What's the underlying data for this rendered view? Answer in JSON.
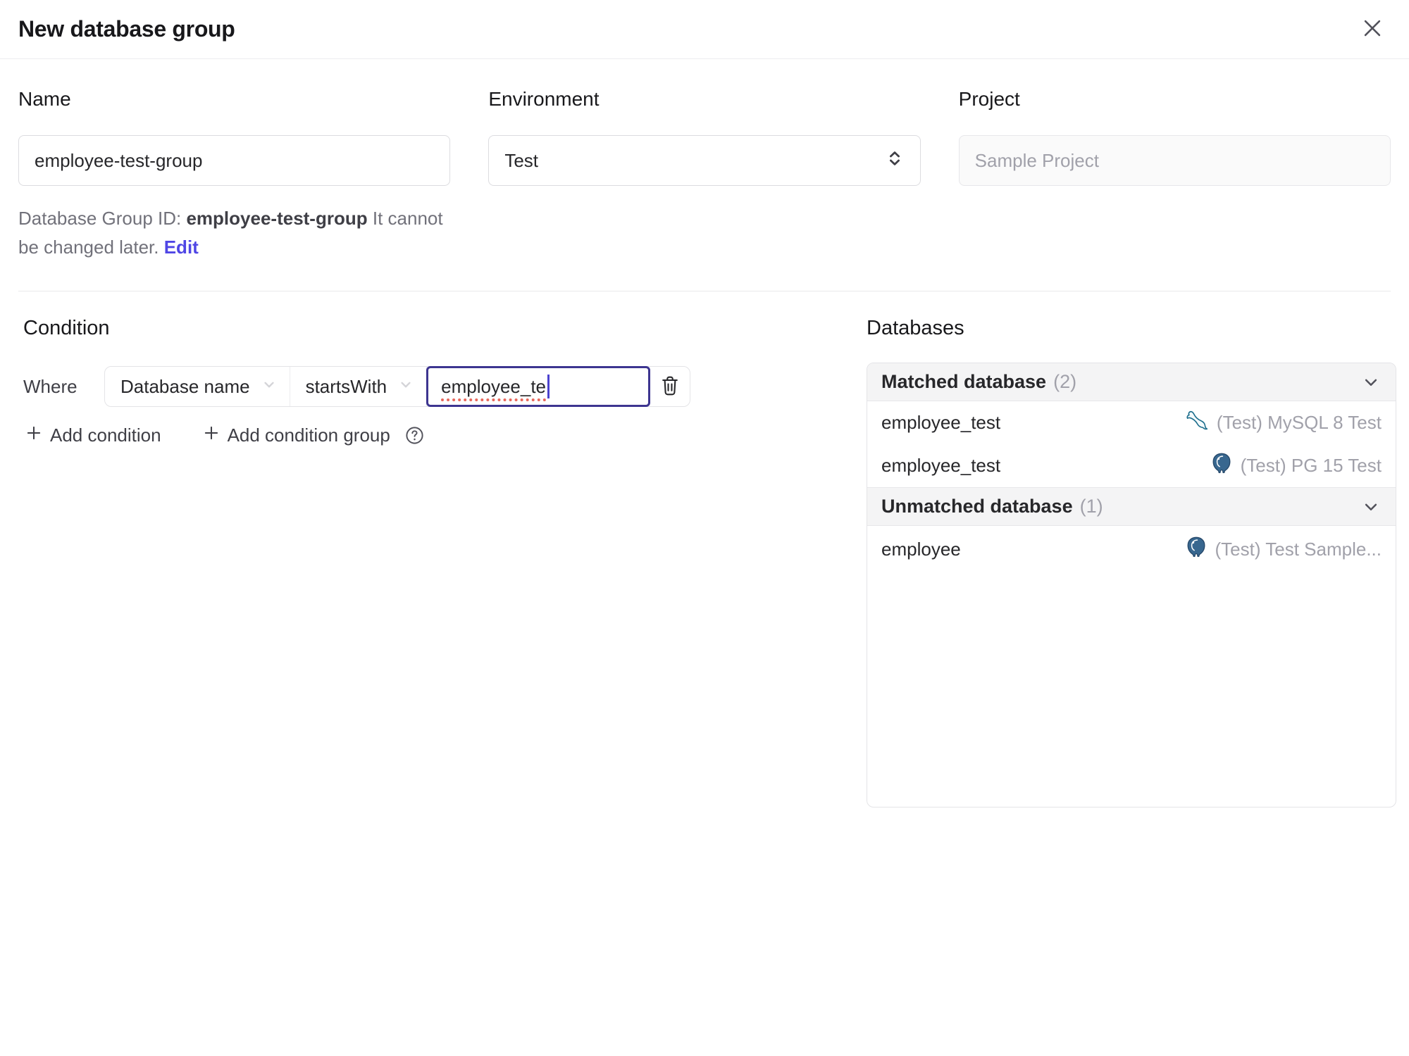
{
  "dialog": {
    "title": "New database group"
  },
  "form": {
    "name": {
      "label": "Name",
      "value": "employee-test-group"
    },
    "environment": {
      "label": "Environment",
      "value": "Test"
    },
    "project": {
      "label": "Project",
      "value": "Sample Project"
    },
    "id_hint": {
      "prefix": "Database Group ID: ",
      "id": "employee-test-group",
      "suffix": " It cannot be changed later. ",
      "edit": "Edit"
    }
  },
  "condition": {
    "heading": "Condition",
    "where": "Where",
    "factor": "Database name",
    "operator": "startsWith",
    "value": "employee_te",
    "add_condition": "Add condition",
    "add_condition_group": "Add condition group",
    "plus": "+"
  },
  "databases": {
    "heading": "Databases",
    "matched": {
      "title": "Matched database",
      "count": "(2)",
      "rows": [
        {
          "name": "employee_test",
          "engine": "mysql",
          "instance": "(Test) MySQL 8 Test"
        },
        {
          "name": "employee_test",
          "engine": "postgres",
          "instance": "(Test) PG 15 Test"
        }
      ]
    },
    "unmatched": {
      "title": "Unmatched database",
      "count": "(1)",
      "rows": [
        {
          "name": "employee",
          "engine": "postgres",
          "instance": "(Test) Test Sample..."
        }
      ]
    }
  },
  "colors": {
    "accent": "#4f46e5",
    "focus_border": "#3d3590",
    "spellcheck_red": "#e8685c",
    "muted_text": "#a1a1aa",
    "group_header_bg": "#f4f4f5",
    "panel_border": "#e4e4e7",
    "mysql_icon": "#1b6d8c",
    "postgres_icon": "#38678f"
  }
}
